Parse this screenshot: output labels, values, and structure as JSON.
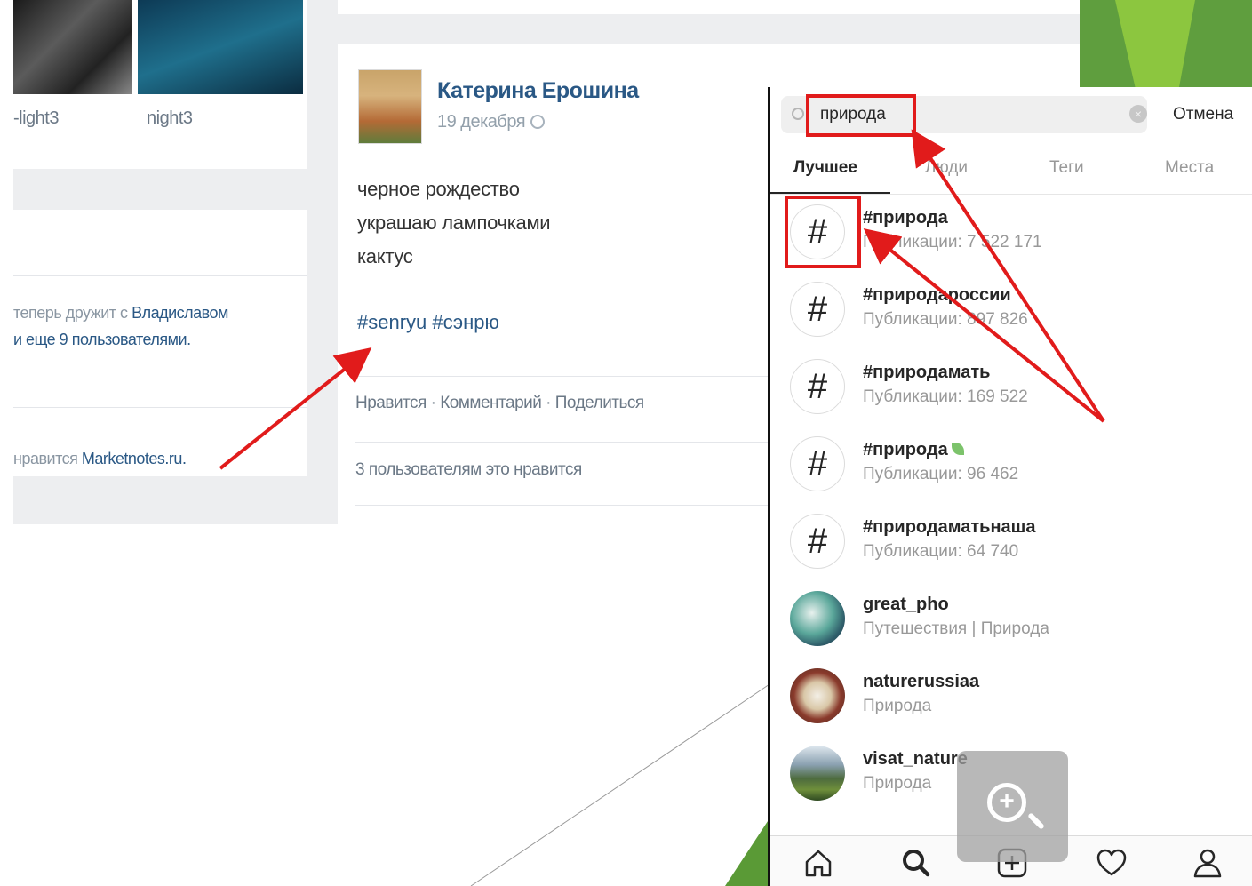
{
  "vk": {
    "photo_labels": [
      "night3",
      "night3"
    ],
    "photo_label_left_cropped": "-light3",
    "friend_text_pre": "теперь дружит с",
    "friend_link": "Владиславом",
    "friend_text_post": "и еще 9 пользователями.",
    "likes_pre": "нравится",
    "likes_link": "Marketnotes.ru.",
    "post": {
      "author": "Катерина Ерошина",
      "date": "19 декабря",
      "lines": [
        "черное рождество",
        "украшаю лампочками",
        "кактус"
      ],
      "hashtags": "#senryu #сэнрю",
      "actions": "Нравится · Комментарий · Поделиться",
      "likes_summary": "3 пользователям это нравится"
    }
  },
  "instagram": {
    "search": {
      "value": "природа",
      "cancel_label": "Отмена"
    },
    "tabs": [
      {
        "label": "Лучшее",
        "active": true
      },
      {
        "label": "Люди",
        "active": false
      },
      {
        "label": "Теги",
        "active": false
      },
      {
        "label": "Места",
        "active": false
      }
    ],
    "results": [
      {
        "type": "tag",
        "name": "#природа",
        "subtitle": "Публикации: 7 522 171"
      },
      {
        "type": "tag",
        "name": "#природароссии",
        "subtitle": "Публикации: 897 826"
      },
      {
        "type": "tag",
        "name": "#природамать",
        "subtitle": "Публикации: 169 522"
      },
      {
        "type": "tag",
        "name": "#природа",
        "subtitle": "Публикации: 96 462"
      },
      {
        "type": "tag",
        "name": "#природаматьнаша",
        "subtitle": "Публикации: 64 740"
      },
      {
        "type": "account",
        "name": "great_pho",
        "subtitle": "Путешествия | Природа"
      },
      {
        "type": "account",
        "name": "naturerussiaa",
        "subtitle": "Природа"
      },
      {
        "type": "account",
        "name": "visat_nature",
        "subtitle": "Природа"
      }
    ],
    "nav_icons": [
      "home-icon",
      "search-icon",
      "add-icon",
      "heart-icon",
      "profile-icon"
    ]
  },
  "colors": {
    "vk_link": "#2a5885",
    "annotation_red": "#e11b1b",
    "deco_green": "#5f9e3e"
  }
}
